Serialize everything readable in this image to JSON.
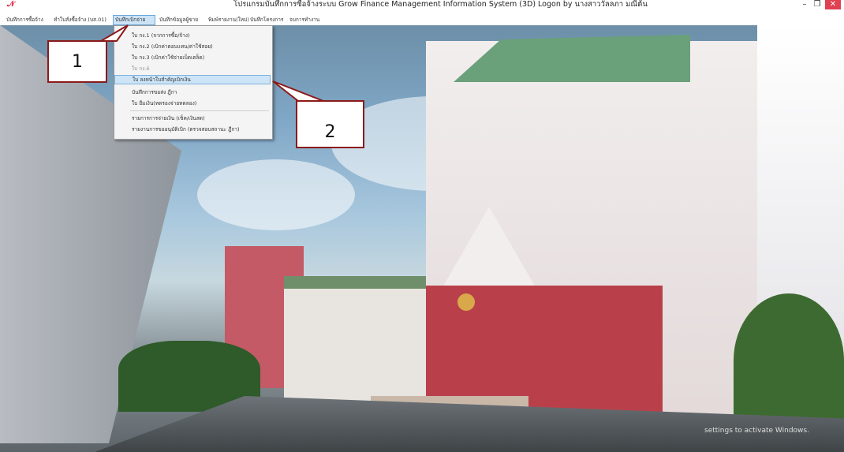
{
  "window": {
    "logo": "𝒩",
    "title": "โปรแกรมบันทึกการซื้อจ้างระบบ  Grow Finance Management Information System (3D) Logon by นางสาววัลลภา  มณีต้น",
    "minimize": "–",
    "maximize": "❐",
    "close": "✕"
  },
  "menubar": {
    "items": [
      {
        "label": "บันทึกการซื้อจ้าง"
      },
      {
        "label": "ทำใบสั่งซื้อจ้าง (บส.01)"
      },
      {
        "label": "บันทึกเบิกจ่าย"
      },
      {
        "label": "บันทึกข้อมูลผู้ขาย"
      },
      {
        "label": "พิมพ์รายงาน(ใหม่)"
      },
      {
        "label": "บันทึกโครงการ"
      },
      {
        "label": "จบการทำงาน"
      }
    ]
  },
  "dropdown": {
    "items": [
      {
        "label": "ใบ กง.1 (จากการซื้อ/จ้าง)"
      },
      {
        "label": "ใบ กง.2 (เบิกค่าตอบแทน/ค่าใช้สอย)"
      },
      {
        "label": "ใบ กง.3 (เบิกค่าใช้จ่ายเบ็ดเตล็ด)"
      },
      {
        "label": "ใบ กง.6"
      },
      {
        "label": "ใบ ลงหน้าใบสำคัญเบิกเงิน"
      },
      {
        "label": "บันทึกการขอส่ง ฎีกา"
      },
      {
        "label": "ใบ ยืมเงิน(ทดรองจ่ายทดลอง)"
      },
      {
        "label": "รายการการจ่ายเงิน (เช็ค/เงินสด)"
      },
      {
        "label": "รายงานการขออนุมัติเบิก (ตรวจสอบสถานะ ฎีกา)"
      }
    ]
  },
  "callouts": {
    "one": "1",
    "two": "2"
  },
  "watermark": "settings to activate Windows.",
  "colors": {
    "close": "#e04050",
    "highlight": "#cde4f7",
    "callout_border": "#8b1a1a"
  }
}
